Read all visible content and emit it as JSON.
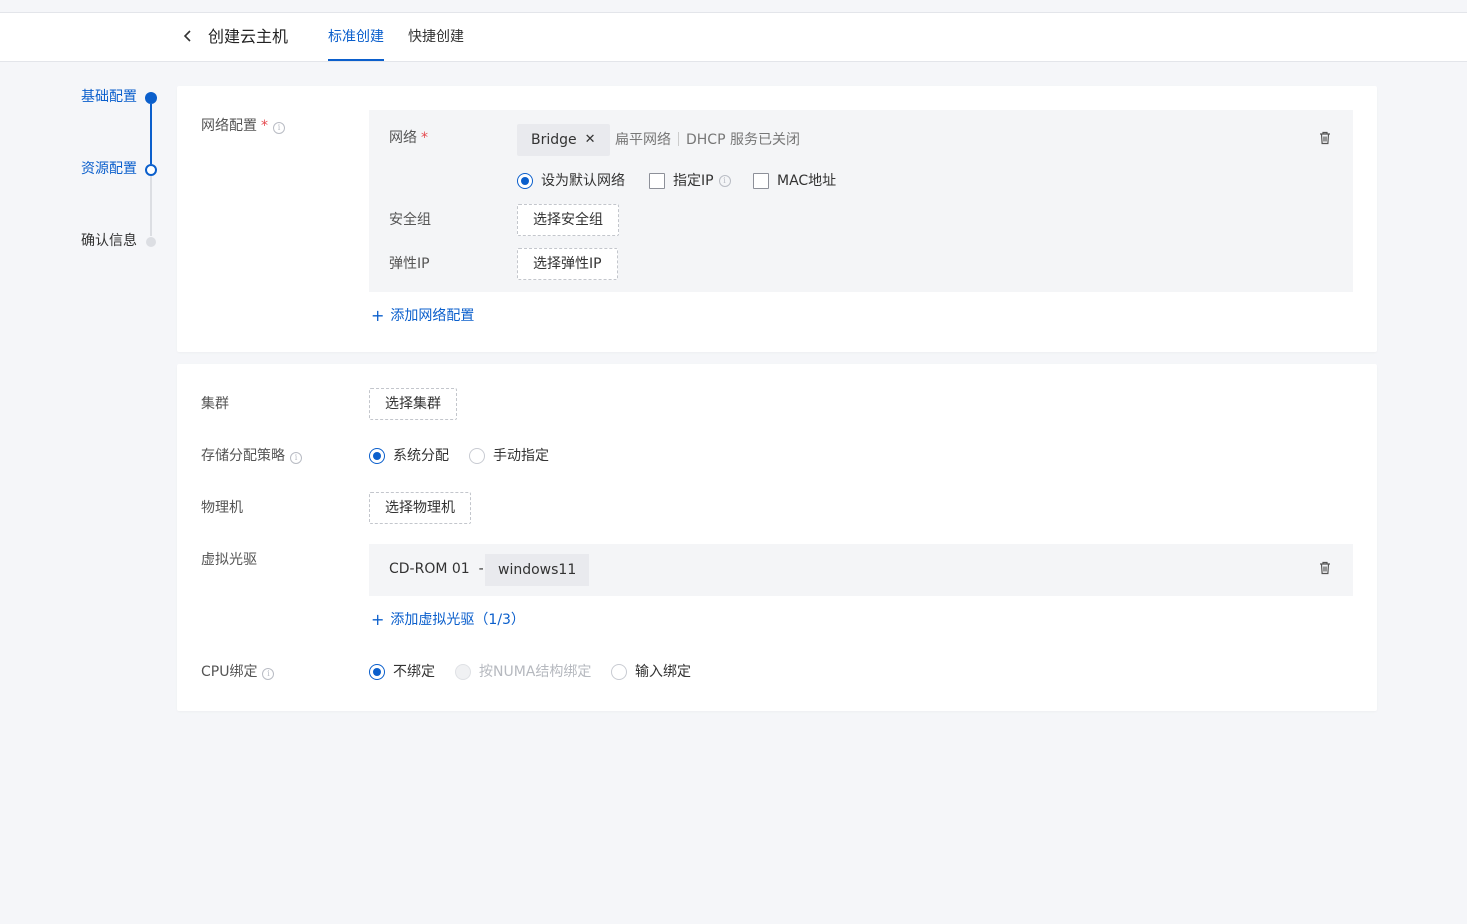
{
  "header": {
    "title": "创建云主机",
    "tabs": [
      {
        "label": "标准创建",
        "active": true
      },
      {
        "label": "快捷创建",
        "active": false
      }
    ]
  },
  "steps": [
    {
      "label": "基础配置",
      "state": "done"
    },
    {
      "label": "资源配置",
      "state": "current"
    },
    {
      "label": "确认信息",
      "state": "todo"
    }
  ],
  "network_section": {
    "label": "网络配置",
    "required_mark": "*",
    "network": {
      "label": "网络",
      "required_mark": "*",
      "selected_tag": "Bridge",
      "type": "扁平网络",
      "dhcp_status": "DHCP 服务已关闭",
      "options": {
        "default_network": {
          "label": "设为默认网络",
          "checked": true
        },
        "specify_ip": {
          "label": "指定IP",
          "checked": false
        },
        "mac_address": {
          "label": "MAC地址",
          "checked": false
        }
      }
    },
    "security_group": {
      "label": "安全组",
      "button": "选择安全组"
    },
    "elastic_ip": {
      "label": "弹性IP",
      "button": "选择弹性IP"
    },
    "add_link": "添加网络配置"
  },
  "resource_section": {
    "cluster": {
      "label": "集群",
      "button": "选择集群"
    },
    "storage_policy": {
      "label": "存储分配策略",
      "options": [
        {
          "label": "系统分配",
          "selected": true
        },
        {
          "label": "手动指定",
          "selected": false
        }
      ]
    },
    "host": {
      "label": "物理机",
      "button": "选择物理机"
    },
    "cdrom": {
      "label": "虚拟光驱",
      "device": "CD-ROM 01",
      "separator": "-",
      "image": "windows11",
      "add_link": "添加虚拟光驱（1/3）"
    },
    "cpu_binding": {
      "label": "CPU绑定",
      "options": [
        {
          "label": "不绑定",
          "selected": true,
          "disabled": false
        },
        {
          "label": "按NUMA结构绑定",
          "selected": false,
          "disabled": true
        },
        {
          "label": "输入绑定",
          "selected": false,
          "disabled": false
        }
      ]
    }
  },
  "colors": {
    "accent": "#0b5fcc",
    "required": "#e5484d",
    "background": "#f5f6f9",
    "panel": "#f4f5f7"
  }
}
